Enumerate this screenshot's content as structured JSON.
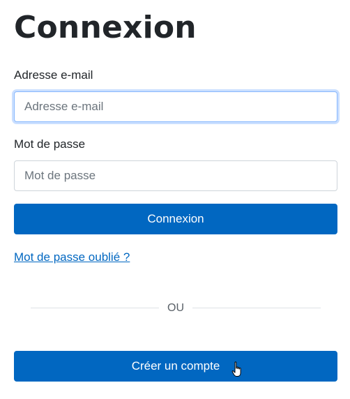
{
  "page": {
    "title": "Connexion"
  },
  "form": {
    "email": {
      "label": "Adresse e-mail",
      "placeholder": "Adresse e-mail",
      "value": ""
    },
    "password": {
      "label": "Mot de passe",
      "placeholder": "Mot de passe",
      "value": ""
    },
    "submit_label": "Connexion",
    "forgot_link": "Mot de passe oublié ?"
  },
  "divider": {
    "text": "OU"
  },
  "create_account_label": "Créer un compte",
  "colors": {
    "primary": "#0167c1",
    "text": "#212529",
    "border": "#ced4da",
    "focus_ring": "#86b7fe"
  },
  "icons": {
    "cursor": "hand-pointer-icon"
  }
}
